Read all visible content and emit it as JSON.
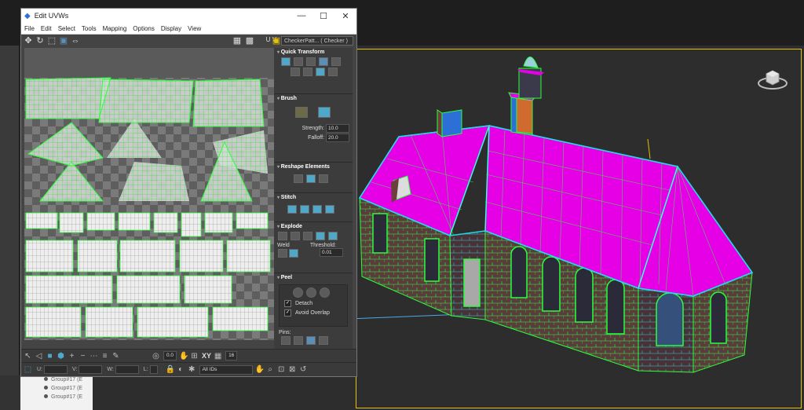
{
  "window": {
    "title": "Edit UVWs",
    "controls": [
      "—",
      "☐",
      "✕"
    ]
  },
  "menu": [
    "File",
    "Edit",
    "Select",
    "Tools",
    "Mapping",
    "Options",
    "Display",
    "View"
  ],
  "toolbar": {
    "uv_label": "U V",
    "texture_dropdown": "CheckerPatt... ( Checker )"
  },
  "panel": {
    "quick_transform": {
      "title": "Quick Transform"
    },
    "brush": {
      "title": "Brush",
      "strength_label": "Strength:",
      "strength_value": "10.0",
      "falloff_label": "Falloff:",
      "falloff_value": "20.0"
    },
    "reshape": {
      "title": "Reshape Elements"
    },
    "stitch": {
      "title": "Stitch"
    },
    "explode": {
      "title": "Explode",
      "weld_label": "Weld",
      "threshold_label": "Threshold:",
      "threshold_value": "0.01"
    },
    "peel": {
      "title": "Peel",
      "detach_label": "Detach",
      "avoid_overlap_label": "Avoid Overlap",
      "pins_label": "Pins:"
    }
  },
  "bottom": {
    "value1": "0.0",
    "xy_label": "XY",
    "value2": "16",
    "u_label": "U:",
    "v_label": "V:",
    "w_label": "W:",
    "l_label": "L:",
    "ids_dropdown": "All IDs"
  },
  "groups": [
    "Group#17 (E",
    "Group#17 (E",
    "Group#17 (E"
  ],
  "colors": {
    "roof": "#e600e6",
    "wireframe": "#33ff33",
    "brick": "#6b3f3b",
    "window": "#2c6fd6",
    "accent_yellow": "#e8c100"
  }
}
